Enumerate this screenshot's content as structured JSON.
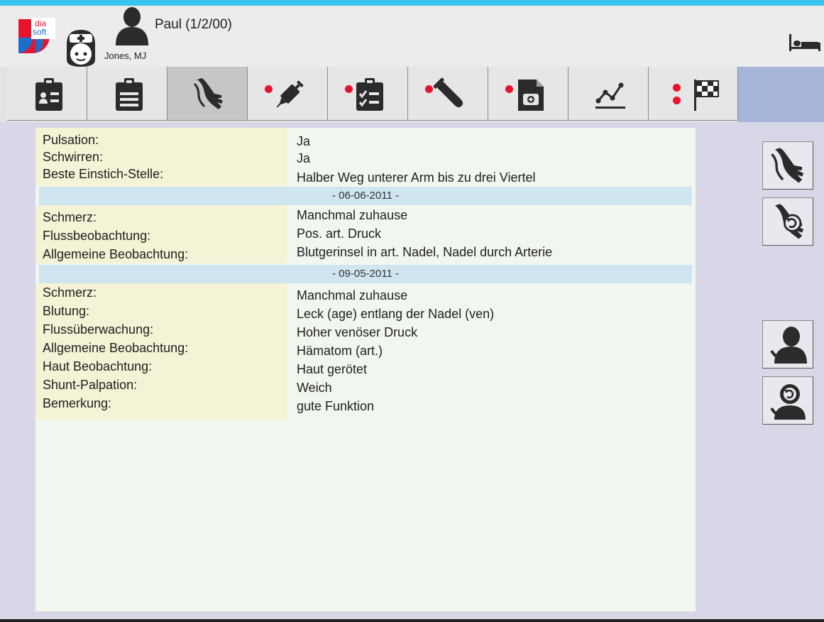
{
  "header": {
    "patient_name": "Paul (1/2/00)",
    "staff_name": "Jones, MJ",
    "logo_text_top": "dia",
    "logo_text_bottom": "soft"
  },
  "tabs": [
    {
      "icon": "clipboard-person-icon",
      "active": false,
      "alert_dots": 0
    },
    {
      "icon": "clipboard-list-icon",
      "active": false,
      "alert_dots": 0
    },
    {
      "icon": "arm-shunt-icon",
      "active": true,
      "alert_dots": 0
    },
    {
      "icon": "syringe-icon",
      "active": false,
      "alert_dots": 1
    },
    {
      "icon": "checklist-icon",
      "active": false,
      "alert_dots": 1
    },
    {
      "icon": "test-tube-icon",
      "active": false,
      "alert_dots": 1
    },
    {
      "icon": "medical-document-icon",
      "active": false,
      "alert_dots": 1
    },
    {
      "icon": "line-chart-icon",
      "active": false,
      "alert_dots": 0
    },
    {
      "icon": "checkered-flag-icon",
      "active": false,
      "alert_dots": 2
    }
  ],
  "section1": {
    "rows": [
      {
        "label": "Pulsation:",
        "value": "Ja"
      },
      {
        "label": "Schwirren:",
        "value": "Ja"
      },
      {
        "label": "Beste Einstich-Stelle:",
        "value": "Halber Weg unterer Arm bis zu drei Viertel"
      }
    ]
  },
  "section2": {
    "date": "- 06-06-2011 -",
    "rows": [
      {
        "label": "Schmerz:",
        "value": "Manchmal zuhause"
      },
      {
        "label": "Flussbeobachtung:",
        "value": "Pos. art. Druck"
      },
      {
        "label": "Allgemeine Beobachtung:",
        "value": "Blutgerinsel in art. Nadel, Nadel durch Arterie"
      }
    ]
  },
  "section3": {
    "date": "- 09-05-2011 -",
    "rows": [
      {
        "label": "Schmerz:",
        "value": "Manchmal zuhause"
      },
      {
        "label": "Blutung:",
        "value": "Leck (age) entlang der Nadel (ven)"
      },
      {
        "label": "Flussüberwachung:",
        "value": "Hoher venöser Druck"
      },
      {
        "label": "Allgemeine Beobachtung:",
        "value": "Hämatom (art.)"
      },
      {
        "label": "Haut Beobachtung:",
        "value": "Haut gerötet"
      },
      {
        "label": "Shunt-Palpation:",
        "value": "Weich"
      },
      {
        "label": "Bemerkung:",
        "value": "gute Funktion"
      }
    ]
  },
  "colors": {
    "accent_top": "#37c4ef",
    "alert_dot": "#e8142e",
    "label_bg": "#f4f3d5",
    "date_band": "#cfe5f0"
  }
}
